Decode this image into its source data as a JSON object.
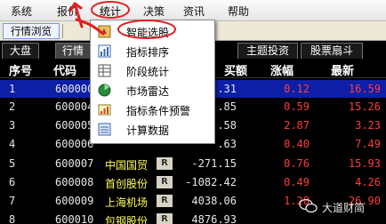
{
  "menubar": {
    "items": [
      "系统",
      "报价",
      "统计",
      "决策",
      "资讯",
      "帮助"
    ]
  },
  "toolbar": {
    "button_label": "行情浏览"
  },
  "tabs": [
    "大盘",
    "行情",
    "主题投资",
    "股票扇斗"
  ],
  "table": {
    "columns": [
      "序号",
      "代码",
      "买额",
      "涨幅",
      "最新"
    ],
    "rows": [
      {
        "idx": "1",
        "code": "600000",
        "name": "",
        "amount": ".31",
        "change": "0.12",
        "last": "16.59",
        "dir": "up",
        "selected": true
      },
      {
        "idx": "2",
        "code": "600004",
        "name": "",
        "amount": ".85",
        "change": "0.59",
        "last": "15.26",
        "dir": "up"
      },
      {
        "idx": "3",
        "code": "600005",
        "name": "",
        "amount": ".58",
        "change": "2.87",
        "last": "3.23",
        "dir": "up"
      },
      {
        "idx": "4",
        "code": "600006",
        "name": "",
        "amount": ".63",
        "change": "0.40",
        "last": "7.49",
        "dir": "up"
      },
      {
        "idx": "5",
        "code": "600007",
        "name": "中国国贸",
        "amount": "-271.15",
        "change": "0.76",
        "last": "15.93",
        "dir": "up"
      },
      {
        "idx": "6",
        "code": "600008",
        "name": "首创股份",
        "amount": "-1082.42",
        "change": "0.49",
        "last": "4.26",
        "dir": "up"
      },
      {
        "idx": "7",
        "code": "600009",
        "name": "上海机场",
        "amount": "4038.06",
        "change": "1.28",
        "last": "26.90",
        "dir": "up"
      },
      {
        "idx": "8",
        "code": "600010",
        "name": "包钢股份",
        "amount": "4876.93",
        "change": "",
        "last": "",
        "dir": "up"
      }
    ],
    "badge": "R"
  },
  "dropdown": {
    "items": [
      {
        "label": "智能选股",
        "icon": "smart-pick-icon"
      },
      {
        "label": "指标排序",
        "icon": "indicator-sort-icon"
      },
      {
        "label": "阶段统计",
        "icon": "stage-stats-icon"
      },
      {
        "label": "市场雷达",
        "icon": "market-radar-icon"
      },
      {
        "label": "指标条件预警",
        "icon": "condition-alert-icon"
      },
      {
        "label": "计算数据",
        "icon": "calc-data-icon"
      }
    ]
  },
  "watermark": {
    "text": "大道财简"
  },
  "colors": {
    "up": "#ff3c3c",
    "down": "#22dd22",
    "name": "#ffff55",
    "selected_row": "#0c1fa6",
    "annotation": "#e02020"
  }
}
